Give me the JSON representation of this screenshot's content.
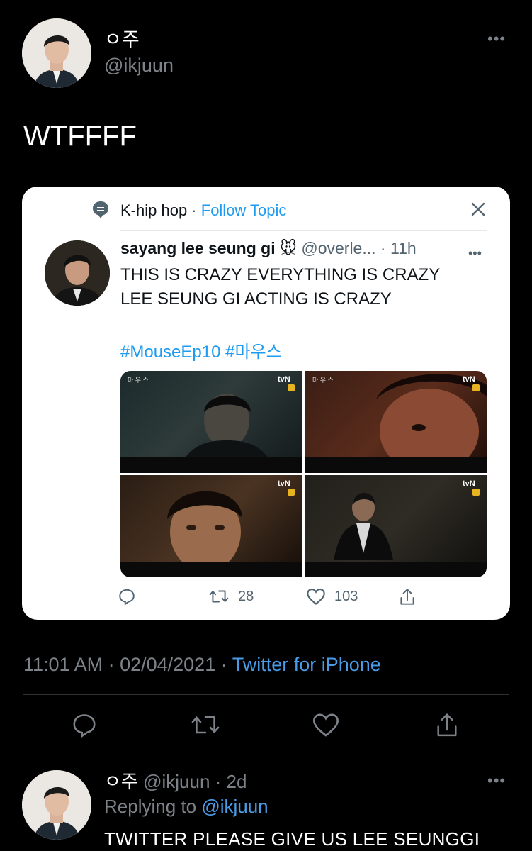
{
  "tweet": {
    "author_name": "ㅇ주",
    "author_handle": "@ikjuun",
    "text": "WTFFFF",
    "time": "11:01 AM",
    "date": "02/04/2021",
    "source": "Twitter for iPhone"
  },
  "quote": {
    "topic_name": "K-hip hop",
    "topic_sep": " · ",
    "topic_follow": "Follow Topic",
    "author_name": "sayang lee seung gi 🐭",
    "author_handle": "@overle...",
    "time_ago": "11h",
    "text_line1": "THIS IS CRAZY EVERYTHING IS CRAZY",
    "text_line2": "LEE SEUNG GI ACTING IS CRAZY",
    "hashtags": "#MouseEp10 #마우스",
    "retweet_count": "28",
    "like_count": "103",
    "media": [
      {
        "title": "마 우 스",
        "channel": "tvN"
      },
      {
        "title": "마 우 스",
        "channel": "tvN"
      },
      {
        "title": "",
        "channel": "tvN"
      },
      {
        "title": "",
        "channel": "tvN"
      }
    ]
  },
  "reply": {
    "author_name": "ㅇ주",
    "author_handle": "@ikjuun",
    "time_ago": "2d",
    "replying_label": "Replying to",
    "replying_to": "@ikjuun",
    "text": "TWITTER PLEASE GIVE US LEE SEUNGGI"
  },
  "icons": [
    "more-icon",
    "topic-icon",
    "close-icon",
    "reply-icon",
    "retweet-icon",
    "like-icon",
    "share-icon"
  ],
  "colors": {
    "background": "#000000",
    "link": "#4a9be6",
    "card": "#ffffff",
    "hashtag": "#1d9bf0",
    "muted": "#7d8288"
  }
}
